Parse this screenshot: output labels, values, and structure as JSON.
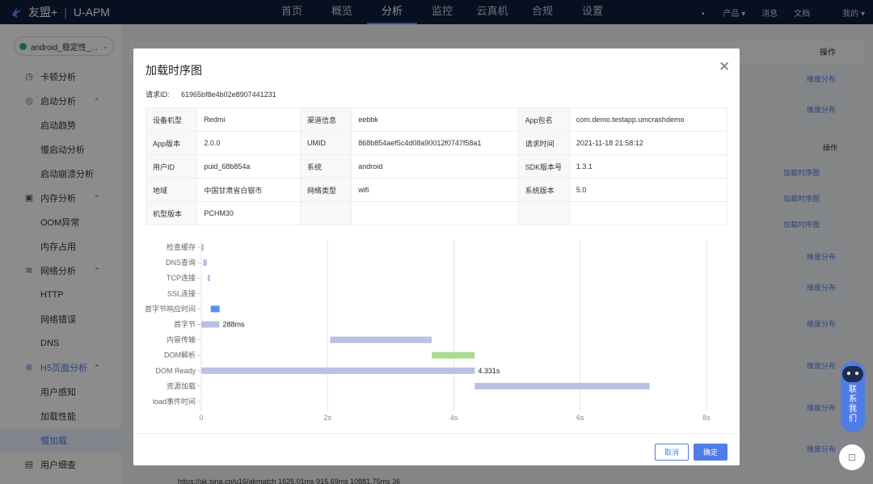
{
  "topnav": {
    "brand": "友盟+",
    "product": "U-APM",
    "items": [
      "首页",
      "概览",
      "分析",
      "监控",
      "云真机",
      "合规",
      "设置"
    ],
    "active_index": 2,
    "right": {
      "products": "产品",
      "messages": "消息",
      "docs": "文档",
      "mine": "我的"
    }
  },
  "sidebar": {
    "app_select": "android_稳定性_...",
    "menu": [
      {
        "type": "group",
        "label": "卡顿分析",
        "icon": "clock-icon"
      },
      {
        "type": "group",
        "label": "启动分析",
        "icon": "gauge-icon",
        "chevron": "^"
      },
      {
        "type": "sub",
        "label": "启动趋势"
      },
      {
        "type": "sub",
        "label": "慢启动分析"
      },
      {
        "type": "sub",
        "label": "启动崩溃分析"
      },
      {
        "type": "group",
        "label": "内存分析",
        "icon": "save-icon",
        "chevron": "^"
      },
      {
        "type": "sub",
        "label": "OOM异常"
      },
      {
        "type": "sub",
        "label": "内存占用"
      },
      {
        "type": "group",
        "label": "网络分析",
        "icon": "wifi-icon",
        "chevron": "^"
      },
      {
        "type": "sub",
        "label": "HTTP"
      },
      {
        "type": "sub",
        "label": "网络错误"
      },
      {
        "type": "sub",
        "label": "DNS"
      },
      {
        "type": "group",
        "label": "H5页面分析",
        "icon": "h5-icon",
        "chevron": "^",
        "highlight": true
      },
      {
        "type": "sub",
        "label": "用户感知"
      },
      {
        "type": "sub",
        "label": "加载性能"
      },
      {
        "type": "sub",
        "label": "慢加载",
        "active": true
      },
      {
        "type": "group",
        "label": "用户细查",
        "icon": "user-detail-icon"
      }
    ]
  },
  "background": {
    "header_op": "操作",
    "inner_op": "操作",
    "links_distribution": "维度分布",
    "links_timing": "加载时序图",
    "bottom_row": "https://ak.sina.cn/u16/akmatch      1625.01ms      915.69ms      10881.75ms      36"
  },
  "modal": {
    "title": "加载时序图",
    "req_id_label": "请求ID:",
    "req_id_value": "61965bf8e4b02e8907441231",
    "info_rows": [
      [
        {
          "k": "设备机型",
          "v": "Redmi"
        },
        {
          "k": "渠道信息",
          "v": "eebbk"
        },
        {
          "k": "App包名",
          "v": "com.demo.testapp.umcrashdemo"
        }
      ],
      [
        {
          "k": "App版本",
          "v": "2.0.0"
        },
        {
          "k": "UMID",
          "v": "868b854aef5c4d08a90012f0747f58a1"
        },
        {
          "k": "请求时间",
          "v": "2021-11-18 21:58:12"
        }
      ],
      [
        {
          "k": "用户ID",
          "v": "puid_68b854a"
        },
        {
          "k": "系统",
          "v": "android"
        },
        {
          "k": "SDK版本号",
          "v": "1.3.1"
        }
      ],
      [
        {
          "k": "地域",
          "v": "中国甘肃省白银市"
        },
        {
          "k": "网络类型",
          "v": "wifi"
        },
        {
          "k": "系统版本",
          "v": "5.0"
        }
      ],
      [
        {
          "k": "机型版本",
          "v": "PCHM30"
        },
        {
          "k": "",
          "v": ""
        },
        {
          "k": "",
          "v": ""
        }
      ]
    ],
    "cancel": "取消",
    "ok": "确定"
  },
  "chart_data": {
    "type": "bar",
    "orientation": "horizontal-gantt",
    "categories": [
      "检查缓存",
      "DNS查询",
      "TCP连接",
      "SSL连接",
      "首字节响应时间",
      "首字节",
      "内容传输",
      "DOM解析",
      "DOM Ready",
      "资源加载",
      "load事件时间"
    ],
    "ranges_ms": [
      [
        0,
        40
      ],
      [
        30,
        90
      ],
      [
        100,
        140
      ],
      null,
      [
        150,
        290
      ],
      [
        0,
        288
      ],
      [
        2040,
        3650
      ],
      [
        3650,
        4331
      ],
      [
        0,
        4331
      ],
      [
        4331,
        7100
      ],
      null
    ],
    "colors": [
      "#b9c2e0",
      "#b9c2e0",
      "#b9c2e0",
      null,
      "#5b8ff0",
      "#b9c2e0",
      "#b9c2e0",
      "#a8dc8f",
      "#b9c2e0",
      "#b9c2e0",
      null
    ],
    "data_labels": {
      "5": "288ms",
      "8": "4.331s"
    },
    "xticks": [
      "0",
      "2s",
      "4s",
      "6s",
      "8s"
    ],
    "xlim_ms": [
      0,
      8000
    ],
    "grid": true
  },
  "widgets": {
    "contact": "联系我们"
  }
}
